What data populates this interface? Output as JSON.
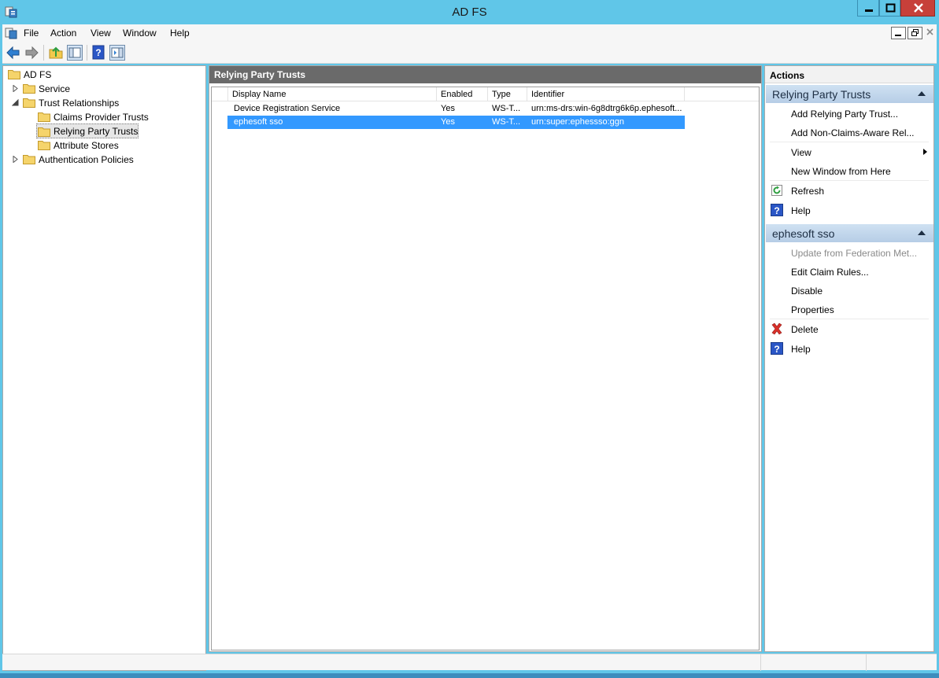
{
  "window": {
    "title": "AD FS"
  },
  "menu": [
    "File",
    "Action",
    "View",
    "Window",
    "Help"
  ],
  "tree": {
    "root": "AD FS",
    "service": "Service",
    "trust_relationships": "Trust Relationships",
    "claims_provider_trusts": "Claims Provider Trusts",
    "relying_party_trusts": "Relying Party Trusts",
    "attribute_stores": "Attribute Stores",
    "authentication_policies": "Authentication Policies"
  },
  "center": {
    "header": "Relying Party Trusts",
    "columns": {
      "display_name": "Display Name",
      "enabled": "Enabled",
      "type": "Type",
      "identifier": "Identifier"
    },
    "rows": [
      {
        "display_name": "Device Registration Service",
        "enabled": "Yes",
        "type": "WS-T...",
        "identifier": "urn:ms-drs:win-6g8dtrg6k6p.ephesoft...."
      },
      {
        "display_name": "ephesoft sso",
        "enabled": "Yes",
        "type": "WS-T...",
        "identifier": "urn:super:ephessso:ggn"
      }
    ]
  },
  "actions": {
    "title": "Actions",
    "section1": {
      "title": "Relying Party Trusts",
      "add_rp": "Add Relying Party Trust...",
      "add_nca": "Add Non-Claims-Aware Rel...",
      "view": "View",
      "new_window": "New Window from Here",
      "refresh": "Refresh",
      "help": "Help"
    },
    "section2": {
      "title": "ephesoft sso",
      "update": "Update from Federation Met...",
      "edit_claims": "Edit Claim Rules...",
      "disable": "Disable",
      "properties": "Properties",
      "delete": "Delete",
      "help": "Help"
    }
  },
  "colors": {
    "titlebar": "#60c6e8",
    "selection": "#3399ff",
    "pane_header": "#6a6a6a",
    "section_header": "#c2d6ec",
    "close_button": "#c7403a"
  }
}
